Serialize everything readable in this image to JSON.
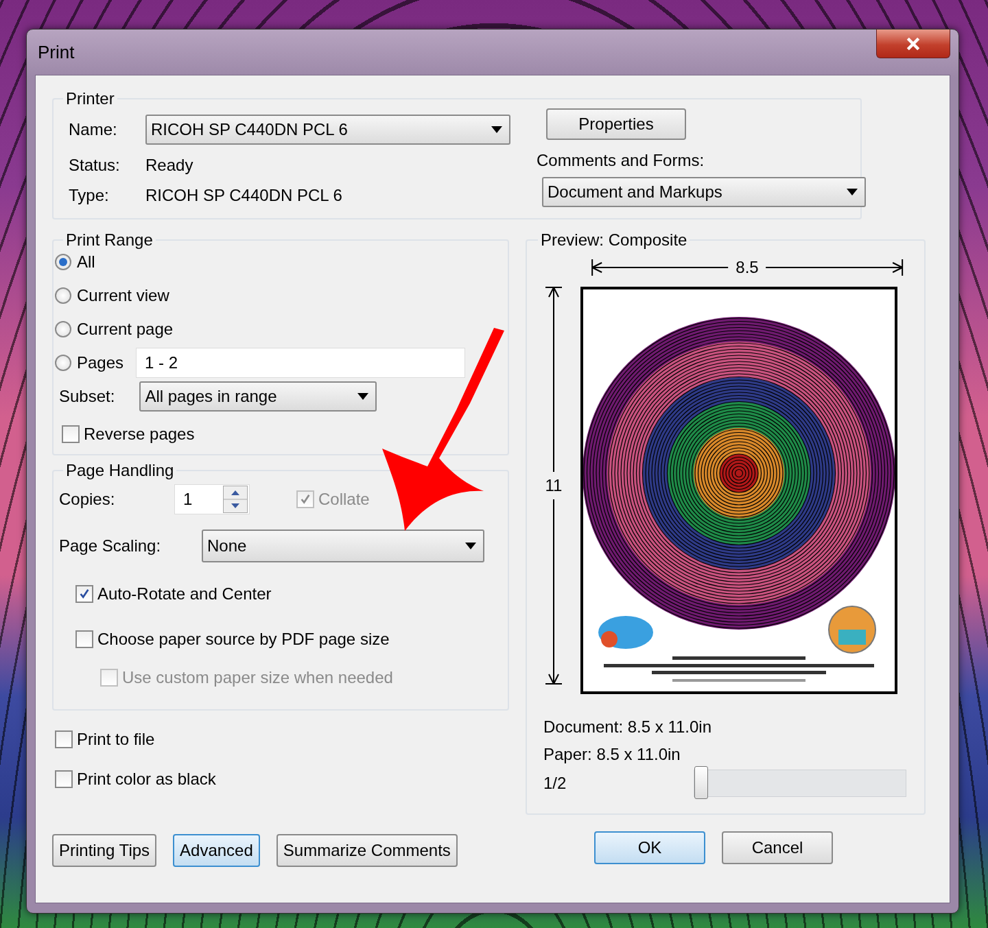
{
  "window": {
    "title": "Print"
  },
  "printer": {
    "title": "Printer",
    "name_label": "Name:",
    "name_value": "RICOH SP C440DN PCL 6",
    "status_label": "Status:",
    "status_value": "Ready",
    "type_label": "Type:",
    "type_value": "RICOH SP C440DN PCL 6",
    "properties_button": "Properties",
    "comments_label": "Comments and Forms:",
    "comments_value": "Document and Markups"
  },
  "print_range": {
    "title": "Print Range",
    "options": [
      {
        "label": "All",
        "selected": true
      },
      {
        "label": "Current view",
        "selected": false
      },
      {
        "label": "Current page",
        "selected": false
      },
      {
        "label": "Pages",
        "selected": false
      }
    ],
    "pages_value": "1 - 2",
    "subset_label": "Subset:",
    "subset_value": "All pages in range",
    "reverse": {
      "label": "Reverse pages",
      "checked": false
    }
  },
  "page_handling": {
    "title": "Page Handling",
    "copies_label": "Copies:",
    "copies_value": "1",
    "collate": {
      "label": "Collate",
      "checked": true,
      "disabled": true
    },
    "scaling_label": "Page Scaling:",
    "scaling_value": "None",
    "options": [
      {
        "label": "Auto-Rotate and Center",
        "checked": true,
        "disabled": false
      },
      {
        "label": "Choose paper source by PDF page size",
        "checked": false,
        "disabled": false,
        "children": [
          {
            "label": "Use custom paper size when needed",
            "checked": false,
            "disabled": true
          }
        ]
      }
    ]
  },
  "output_options": [
    {
      "label": "Print to file",
      "checked": false
    },
    {
      "label": "Print color as black",
      "checked": false
    }
  ],
  "preview": {
    "title": "Preview: Composite",
    "width_label": "8.5",
    "height_label": "11",
    "document": "Document: 8.5 x 11.0in",
    "paper": "Paper: 8.5 x 11.0in",
    "page_indicator": "1/2",
    "slider": {
      "level": 0
    }
  },
  "left_buttons": [
    {
      "label": "Printing Tips",
      "highlighted": false
    },
    {
      "label": "Advanced",
      "highlighted": true
    },
    {
      "label": "Summarize Comments",
      "highlighted": false
    }
  ],
  "right_buttons": [
    {
      "label": "OK",
      "highlighted": true
    },
    {
      "label": "Cancel",
      "highlighted": false
    }
  ]
}
